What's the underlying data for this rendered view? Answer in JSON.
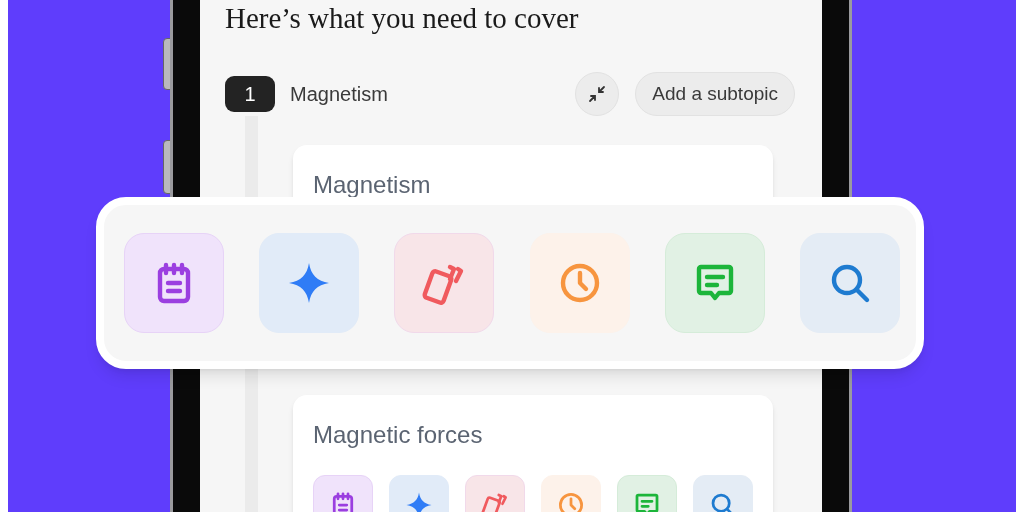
{
  "heading": "Here’s what you need to cover",
  "topic": {
    "number": "1",
    "name": "Magnetism",
    "action": "Add a subtopic"
  },
  "cards": [
    {
      "title": "Magnetism"
    },
    {
      "title": "Magnetic forces"
    }
  ],
  "tools": [
    {
      "kind": "notes"
    },
    {
      "kind": "sparkle"
    },
    {
      "kind": "flashcards"
    },
    {
      "kind": "clock"
    },
    {
      "kind": "chat"
    },
    {
      "kind": "search"
    }
  ]
}
